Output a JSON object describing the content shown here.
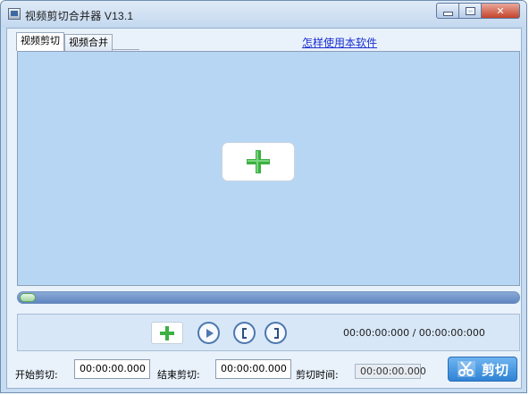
{
  "window": {
    "title": "视频剪切合并器 V13.1",
    "icon": "film-clip-icon"
  },
  "caption_buttons": {
    "minimize_icon": "minimize-icon",
    "maximize_icon": "maximize-icon",
    "close_label": "✕"
  },
  "tabs": [
    {
      "label": "视频剪切",
      "active": true
    },
    {
      "label": "视频合并",
      "active": false
    }
  ],
  "help_link": "怎样使用本软件",
  "preview": {
    "add_icon": "green-plus-icon"
  },
  "playback": {
    "progress": 0.0,
    "time_display": "00:00:00:000 / 00:00:00:000",
    "buttons": [
      {
        "name": "add-video-button",
        "icon": "green-plus-icon"
      },
      {
        "name": "play-button",
        "icon": "play-icon"
      },
      {
        "name": "mark-start-button",
        "icon": "left-bracket-icon"
      },
      {
        "name": "mark-end-button",
        "icon": "right-bracket-icon"
      }
    ]
  },
  "cut_settings": {
    "start_label": "开始剪切:",
    "start_value": "00:00:00.000",
    "end_label": "结束剪切:",
    "end_value": "00:00:00.000",
    "duration_label": "剪切时间:",
    "duration_value": "00:00:00.000",
    "cut_button_label": "剪切",
    "cut_icon": "scissors-icon"
  },
  "colors": {
    "accent_blue": "#2f83d6",
    "plus_green": "#3cb043",
    "preview_bg": "#b7d6f4",
    "link": "#1a2fd1"
  }
}
